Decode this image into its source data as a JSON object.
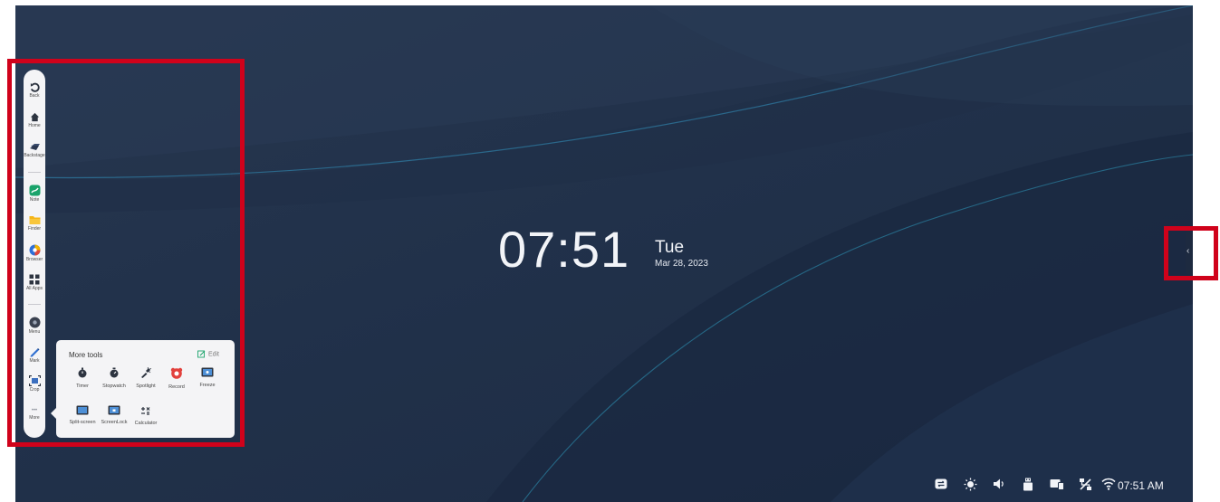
{
  "clock": {
    "time": "07:51",
    "weekday": "Tue",
    "date": "Mar 28, 2023"
  },
  "sidebar": {
    "items": [
      {
        "label": "Back",
        "icon": "back-arrow-icon"
      },
      {
        "label": "Home",
        "icon": "home-icon"
      },
      {
        "label": "Backstage",
        "icon": "backstage-icon"
      },
      {
        "label": "Note",
        "icon": "note-app-icon"
      },
      {
        "label": "Finder",
        "icon": "folder-icon"
      },
      {
        "label": "Browser",
        "icon": "browser-icon"
      },
      {
        "label": "All Apps",
        "icon": "grid-icon"
      },
      {
        "label": "Menu",
        "icon": "menu-icon"
      },
      {
        "label": "Mark",
        "icon": "pen-icon"
      },
      {
        "label": "Crop",
        "icon": "crop-icon"
      },
      {
        "label": "More",
        "icon": "more-icon"
      }
    ]
  },
  "more_tools": {
    "title": "More tools",
    "edit_label": "Edit",
    "tools": [
      {
        "label": "Timer",
        "icon": "timer-icon"
      },
      {
        "label": "Stopwatch",
        "icon": "stopwatch-icon"
      },
      {
        "label": "Spotlight",
        "icon": "spotlight-icon"
      },
      {
        "label": "Record",
        "icon": "record-icon"
      },
      {
        "label": "Freeze",
        "icon": "freeze-icon"
      },
      {
        "label": "Split-screen",
        "icon": "split-screen-icon"
      },
      {
        "label": "ScreenLock",
        "icon": "screenlock-icon"
      },
      {
        "label": "Calculator",
        "icon": "calculator-icon"
      }
    ]
  },
  "status_bar": {
    "icons": [
      "input-source-icon",
      "brightness-icon",
      "volume-icon",
      "usb-icon",
      "cast-icon",
      "network-disconnected-icon",
      "wifi-icon"
    ],
    "time": "07:51 AM"
  },
  "side_handle": {
    "glyph": "‹"
  },
  "colors": {
    "highlight": "#d0021b",
    "background": "#22324b",
    "accent_green": "#1aa36b"
  }
}
